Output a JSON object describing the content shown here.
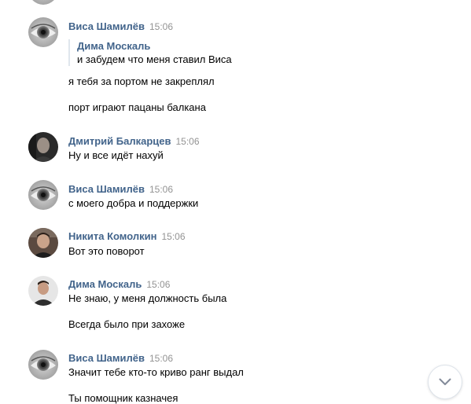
{
  "messages": [
    {
      "author": "Виса Шамилёв",
      "time": "15:06",
      "avatar": "eye-avatar",
      "quote": {
        "author": "Дима Москаль",
        "text": "и забудем что меня ставил Виса"
      },
      "lines": [
        "я тебя за портом не закреплял",
        "порт играют пацаны балкана"
      ]
    },
    {
      "author": "Дмитрий Балкарцев",
      "time": "15:06",
      "avatar": "dark-portrait-avatar",
      "lines": [
        "Ну и все идёт нахуй"
      ]
    },
    {
      "author": "Виса Шамилёв",
      "time": "15:06",
      "avatar": "eye-avatar",
      "lines": [
        "с моего добра и поддержки"
      ]
    },
    {
      "author": "Никита Комолкин",
      "time": "15:06",
      "avatar": "photo-avatar",
      "lines": [
        "Вот это поворот"
      ]
    },
    {
      "author": "Дима Москаль",
      "time": "15:06",
      "avatar": "photo-avatar",
      "lines": [
        "Не знаю, у меня должность была",
        "Всегда было при захоже"
      ]
    },
    {
      "author": "Виса Шамилёв",
      "time": "15:06",
      "avatar": "eye-avatar",
      "lines": [
        "Значит тебе кто-то криво ранг выдал",
        "Ты помощник казначея"
      ]
    }
  ],
  "scroll_button_icon": "chevron-down-icon",
  "colors": {
    "author": "#42648b",
    "time": "#939393",
    "quote_bar": "#dfe6ed"
  }
}
